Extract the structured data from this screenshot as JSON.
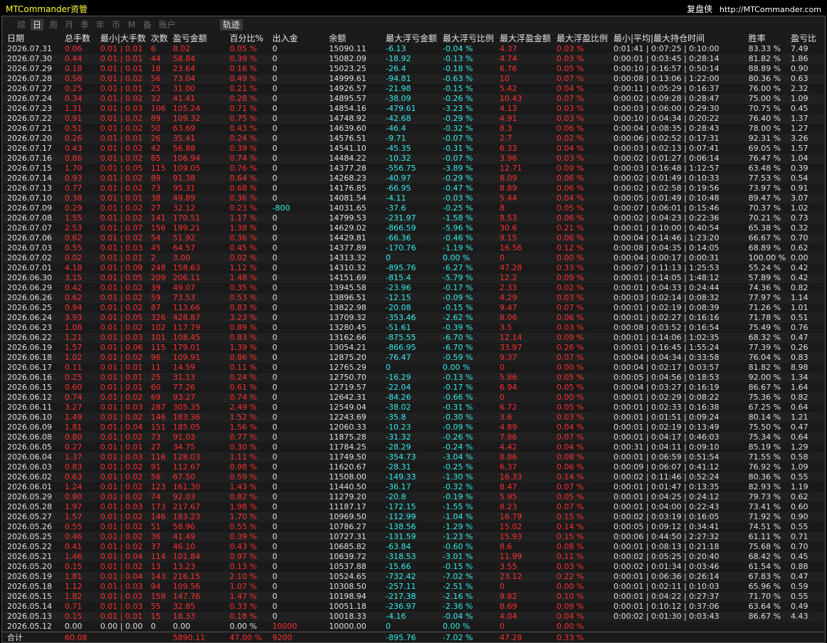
{
  "app": {
    "title": "MTCommander资管",
    "brand_name": "复盘侠",
    "brand_url": "http://MTCommander.com"
  },
  "tabs": [
    "综",
    "日",
    "周",
    "月",
    "季",
    "年",
    "币",
    "M",
    "备",
    "账户"
  ],
  "active_tab": "日",
  "trail_button": "轨迹",
  "colors": {
    "profit": "#ff3030",
    "loss": "#33eeee",
    "title": "#ffff33"
  },
  "columns": [
    "日期",
    "总手数",
    "最小|大手数",
    "次数",
    "盈亏金额",
    "百分比%",
    "出入金",
    "余额",
    "最大浮亏金额",
    "最大浮亏比例",
    "最大浮盈金额",
    "最大浮盈比例",
    "最小|平均|最大持仓时间",
    "胜率",
    "盈亏比"
  ],
  "rows": [
    [
      "2026.07.31",
      "0.06",
      "0.01 | 0.01",
      "6",
      "8.02",
      "0.05 %",
      "0",
      "15090.11",
      "-6.13",
      "-0.04 %",
      "4.37",
      "0.03 %",
      "0:01:41 | 0:07:25 | 0:10:00",
      "83.33 %",
      "7.49"
    ],
    [
      "2026.07.30",
      "0.44",
      "0.01 | 0.01",
      "44",
      "58.84",
      "0.39 %",
      "0",
      "15082.09",
      "-18.92",
      "-0.13 %",
      "4.74",
      "0.03 %",
      "0:00:01 | 0:03:45 | 0:28:14",
      "81.82 %",
      "1.86"
    ],
    [
      "2026.07.29",
      "0.18",
      "0.01 | 0.01",
      "18",
      "23.64",
      "0.16 %",
      "0",
      "15023.25",
      "-26.4",
      "-0.18 %",
      "6.76",
      "0.05 %",
      "0:00:10 | 0:16:57 | 0:50:14",
      "88.89 %",
      "0.90"
    ],
    [
      "2026.07.28",
      "0.58",
      "0.01 | 0.02",
      "56",
      "73.04",
      "0.49 %",
      "0",
      "14999.61",
      "-94.81",
      "-0.63 %",
      "10",
      "0.07 %",
      "0:00:08 | 0:13:06 | 1:22:00",
      "80.36 %",
      "0.63"
    ],
    [
      "2026.07.27",
      "0.25",
      "0.01 | 0.01",
      "25",
      "31.00",
      "0.21 %",
      "0",
      "14926.57",
      "-21.98",
      "-0.15 %",
      "5.42",
      "0.04 %",
      "0:00:11 | 0:05:29 | 0:16:37",
      "76.00 %",
      "2.32"
    ],
    [
      "2026.07.24",
      "0.34",
      "0.01 | 0.02",
      "32",
      "41.41",
      "0.28 %",
      "0",
      "14895.57",
      "-38.09",
      "-0.26 %",
      "10.43",
      "0.07 %",
      "0:00:02 | 0:09:28 | 0:28:47",
      "75.00 %",
      "1.09"
    ],
    [
      "2026.07.23",
      "1.31",
      "0.01 | 0.03",
      "106",
      "105.24",
      "0.71 %",
      "0",
      "14854.16",
      "-479.61",
      "-3.23 %",
      "4.13",
      "0.03 %",
      "0:00:03 | 0:06:00 | 0:29:30",
      "70.75 %",
      "0.45"
    ],
    [
      "2026.07.22",
      "0.91",
      "0.01 | 0.02",
      "89",
      "109.32",
      "0.75 %",
      "0",
      "14748.92",
      "-42.68",
      "-0.29 %",
      "4.91",
      "0.03 %",
      "0:00:10 | 0:04:34 | 0:20:22",
      "76.40 %",
      "1.37"
    ],
    [
      "2026.07.21",
      "0.51",
      "0.01 | 0.02",
      "50",
      "63.69",
      "0.43 %",
      "0",
      "14639.60",
      "-46.4",
      "-0.32 %",
      "8.3",
      "0.06 %",
      "0:00:04 | 0:08:35 | 0:28:43",
      "78.00 %",
      "1.27"
    ],
    [
      "2026.07.20",
      "0.26",
      "0.01 | 0.01",
      "26",
      "35.41",
      "0.24 %",
      "0",
      "14576.51",
      "-9.71",
      "-0.07 %",
      "2.7",
      "0.02 %",
      "0:00:06 | 0:02:52 | 0:17:31",
      "92.31 %",
      "3.26"
    ],
    [
      "2026.07.17",
      "0.43",
      "0.01 | 0.02",
      "42",
      "56.88",
      "0.39 %",
      "0",
      "14541.10",
      "-45.35",
      "-0.31 %",
      "6.33",
      "0.04 %",
      "0:00:03 | 0:02:13 | 0:07:41",
      "69.05 %",
      "1.57"
    ],
    [
      "2026.07.16",
      "0.86",
      "0.01 | 0.02",
      "85",
      "106.94",
      "0.74 %",
      "0",
      "14484.22",
      "-10.32",
      "-0.07 %",
      "3.96",
      "0.03 %",
      "0:00:02 | 0:01:27 | 0:06:14",
      "76.47 %",
      "1.04"
    ],
    [
      "2026.07.15",
      "1.70",
      "0.01 | 0.05",
      "115",
      "109.05",
      "0.76 %",
      "0",
      "14377.28",
      "-556.75",
      "-3.89 %",
      "12.71",
      "0.09 %",
      "0:00:03 | 0:16:48 | 1:12:57",
      "63.48 %",
      "0.39"
    ],
    [
      "2026.07.14",
      "0.93",
      "0.01 | 0.02",
      "89",
      "91.38",
      "0.64 %",
      "0",
      "14268.23",
      "-40.97",
      "-0.29 %",
      "8.09",
      "0.06 %",
      "0:00:02 | 0:01:49 | 0:10:33",
      "77.53 %",
      "0.54"
    ],
    [
      "2026.07.13",
      "0.77",
      "0.01 | 0.02",
      "73",
      "95.31",
      "0.68 %",
      "0",
      "14176.85",
      "-66.95",
      "-0.47 %",
      "8.89",
      "0.06 %",
      "0:00:02 | 0:02:58 | 0:19:56",
      "73.97 %",
      "0.91"
    ],
    [
      "2026.07.10",
      "0.38",
      "0.01 | 0.01",
      "38",
      "49.89",
      "0.36 %",
      "0",
      "14081.54",
      "-4.11",
      "-0.03 %",
      "5.44",
      "0.04 %",
      "0:00:05 | 0:01:49 | 0:10:48",
      "89.47 %",
      "3.07"
    ],
    [
      "2026.07.09",
      "0.29",
      "0.01 | 0.02",
      "27",
      "32.12",
      "0.23 %",
      "-800",
      "14031.65",
      "-37.6",
      "-0.25 %",
      "8",
      "0.05 %",
      "0:00:07 | 0:06:01 | 0:15:46",
      "70.37 %",
      "1.02"
    ],
    [
      "2026.07.08",
      "1.55",
      "0.01 | 0.02",
      "141",
      "170.51",
      "1.17 %",
      "0",
      "14799.53",
      "-231.97",
      "-1.58 %",
      "8.53",
      "0.06 %",
      "0:00:02 | 0:04:23 | 0:22:36",
      "70.21 %",
      "0.73"
    ],
    [
      "2026.07.07",
      "2.53",
      "0.01 | 0.07",
      "156",
      "199.21",
      "1.38 %",
      "0",
      "14629.02",
      "-866.59",
      "-5.96 %",
      "30.6",
      "0.21 %",
      "0:00:01 | 0:10:00 | 0:40:54",
      "65.38 %",
      "0.32"
    ],
    [
      "2026.07.06",
      "0.62",
      "0.01 | 0.02",
      "54",
      "51.92",
      "0.36 %",
      "0",
      "14429.81",
      "-66.36",
      "-0.46 %",
      "9.15",
      "0.06 %",
      "0:00:04 | 0:14:46 | 1:23:20",
      "66.67 %",
      "0.70"
    ],
    [
      "2026.07.03",
      "0.55",
      "0.01 | 0.03",
      "45",
      "64.57",
      "0.45 %",
      "0",
      "14377.89",
      "-170.76",
      "-1.19 %",
      "16.56",
      "0.12 %",
      "0:00:08 | 0:04:35 | 0:14:05",
      "68.89 %",
      "0.62"
    ],
    [
      "2026.07.02",
      "0.02",
      "0.01 | 0.01",
      "2",
      "3.00",
      "0.02 %",
      "0",
      "14313.32",
      "0",
      "0.00 %",
      "0",
      "0.00 %",
      "0:00:04 | 0:00:17 | 0:00:31",
      "100.00 %",
      "0.00"
    ],
    [
      "2026.07.01",
      "4.18",
      "0.01 | 0.09",
      "248",
      "158.63",
      "1.12 %",
      "0",
      "14310.32",
      "-895.76",
      "-6.27 %",
      "47.28",
      "0.33 %",
      "0:00:07 | 0:11:13 | 1:25:53",
      "55.24 %",
      "0.42"
    ],
    [
      "2026.06.30",
      "3.15",
      "0.01 | 0.05",
      "209",
      "206.11",
      "1.48 %",
      "0",
      "14151.69",
      "-815.4",
      "-5.79 %",
      "12.2",
      "0.09 %",
      "0:00:01 | 0:14:05 | 1:48:12",
      "57.89 %",
      "0.42"
    ],
    [
      "2026.06.29",
      "0.42",
      "0.01 | 0.02",
      "39",
      "49.07",
      "0.35 %",
      "0",
      "13945.58",
      "-23.96",
      "-0.17 %",
      "2.33",
      "0.02 %",
      "0:00:01 | 0:04:33 | 0:24:44",
      "74.36 %",
      "0.82"
    ],
    [
      "2026.06.26",
      "0.62",
      "0.01 | 0.02",
      "59",
      "73.53",
      "0.53 %",
      "0",
      "13896.51",
      "-12.15",
      "-0.09 %",
      "4.29",
      "0.03 %",
      "0:00:03 | 0:02:14 | 0:08:32",
      "77.97 %",
      "1.14"
    ],
    [
      "2026.06.25",
      "0.94",
      "0.01 | 0.02",
      "87",
      "113.66",
      "0.83 %",
      "0",
      "13822.98",
      "-20.08",
      "-0.15 %",
      "9.47",
      "0.07 %",
      "0:00:01 | 0:02:19 | 0:08:39",
      "71.26 %",
      "1.01"
    ],
    [
      "2026.06.24",
      "3.93",
      "0.01 | 0.05",
      "326",
      "428.87",
      "3.23 %",
      "0",
      "13709.32",
      "-353.46",
      "-2.62 %",
      "8.06",
      "0.06 %",
      "0:00:01 | 0:02:27 | 0:16:16",
      "71.78 %",
      "0.51"
    ],
    [
      "2026.06.23",
      "1.08",
      "0.01 | 0.02",
      "102",
      "117.79",
      "0.89 %",
      "0",
      "13280.45",
      "-51.61",
      "-0.39 %",
      "3.5",
      "0.03 %",
      "0:00:08 | 0:03:52 | 0:16:54",
      "75.49 %",
      "0.76"
    ],
    [
      "2026.06.22",
      "1.21",
      "0.01 | 0.03",
      "101",
      "108.45",
      "0.83 %",
      "0",
      "13162.66",
      "-875.55",
      "-6.70 %",
      "12.14",
      "0.09 %",
      "0:00:01 | 0:14:06 | 1:02:35",
      "68.32 %",
      "0.47"
    ],
    [
      "2026.06.19",
      "1.57",
      "0.01 | 0.06",
      "115",
      "179.01",
      "1.39 %",
      "0",
      "13054.21",
      "-866.95",
      "-6.70 %",
      "33.97",
      "0.26 %",
      "0:00:01 | 0:16:45 | 1:55:24",
      "77.39 %",
      "0.26"
    ],
    [
      "2026.06.18",
      "1.02",
      "0.01 | 0.02",
      "96",
      "109.91",
      "0.86 %",
      "0",
      "12875.20",
      "-76.47",
      "-0.59 %",
      "9.37",
      "0.07 %",
      "0:00:04 | 0:04:34 | 0:33:58",
      "76.04 %",
      "0.83"
    ],
    [
      "2026.06.17",
      "0.11",
      "0.01 | 0.01",
      "11",
      "14.59",
      "0.11 %",
      "0",
      "12765.29",
      "0",
      "0.00 %",
      "0",
      "0.00 %",
      "0:00:04 | 0:02:17 | 0:03:57",
      "81.82 %",
      "8.98"
    ],
    [
      "2026.06.16",
      "0.25",
      "0.01 | 0.01",
      "25",
      "31.13",
      "0.24 %",
      "0",
      "12750.70",
      "-16.29",
      "-0.13 %",
      "5.86",
      "0.05 %",
      "0:00:05 | 0:04:56 | 0:18:53",
      "92.00 %",
      "1.34"
    ],
    [
      "2026.06.15",
      "0.60",
      "0.01 | 0.01",
      "60",
      "77.26",
      "0.61 %",
      "0",
      "12719.57",
      "-22.04",
      "-0.17 %",
      "6.94",
      "0.05 %",
      "0:00:04 | 0:03:27 | 0:16:19",
      "86.67 %",
      "1.64"
    ],
    [
      "2026.06.12",
      "0.74",
      "0.01 | 0.02",
      "69",
      "93.27",
      "0.74 %",
      "0",
      "12642.31",
      "-84.26",
      "-0.66 %",
      "0",
      "0.00 %",
      "0:00:01 | 0:02:29 | 0:08:22",
      "75.36 %",
      "0.82"
    ],
    [
      "2026.06.11",
      "3.27",
      "0.01 | 0.03",
      "287",
      "305.35",
      "2.49 %",
      "0",
      "12549.04",
      "-38.02",
      "-0.31 %",
      "6.72",
      "0.05 %",
      "0:00:01 | 0:02:33 | 0:16:38",
      "67.25 %",
      "0.64"
    ],
    [
      "2026.06.10",
      "1.49",
      "0.01 | 0.02",
      "146",
      "183.36",
      "1.52 %",
      "0",
      "12243.69",
      "-35.8",
      "-0.30 %",
      "3.6",
      "0.03 %",
      "0:00:01 | 0:01:51 | 0:09:24",
      "80.14 %",
      "1.21"
    ],
    [
      "2026.06.09",
      "1.81",
      "0.01 | 0.04",
      "151",
      "185.05",
      "1.56 %",
      "0",
      "12060.33",
      "-10.23",
      "-0.09 %",
      "4.89",
      "0.04 %",
      "0:00:01 | 0:02:19 | 0:13:49",
      "75.50 %",
      "0.47"
    ],
    [
      "2026.06.08",
      "0.80",
      "0.01 | 0.02",
      "73",
      "91.03",
      "0.77 %",
      "0",
      "11875.28",
      "-31.32",
      "-0.26 %",
      "7.86",
      "0.07 %",
      "0:00:01 | 0:04:17 | 0:46:03",
      "75.34 %",
      "0.64"
    ],
    [
      "2026.06.05",
      "0.27",
      "0.01 | 0.01",
      "27",
      "34.75",
      "0.30 %",
      "0",
      "11784.25",
      "-28.29",
      "-0.24 %",
      "4.42",
      "0.04 %",
      "0:00:31 | 0:04:11 | 0:09:10",
      "85.19 %",
      "1.29"
    ],
    [
      "2026.06.04",
      "1.37",
      "0.01 | 0.03",
      "116",
      "128.03",
      "1.11 %",
      "0",
      "11749.50",
      "-354.73",
      "-3.04 %",
      "8.86",
      "0.08 %",
      "0:00:01 | 0:06:59 | 0:51:54",
      "71.55 %",
      "0.58"
    ],
    [
      "2026.06.03",
      "0.83",
      "0.01 | 0.02",
      "91",
      "112.67",
      "0.98 %",
      "0",
      "11620.67",
      "-28.31",
      "-0.25 %",
      "6.37",
      "0.06 %",
      "0:00:09 | 0:06:07 | 0:41:12",
      "76.92 %",
      "1.09"
    ],
    [
      "2026.06.02",
      "0.63",
      "0.01 | 0.02",
      "56",
      "67.50",
      "0.59 %",
      "0",
      "11508.00",
      "-149.33",
      "-1.30 %",
      "16.33",
      "0.14 %",
      "0:00:02 | 0:11:46 | 0:52:24",
      "80.36 %",
      "0.55"
    ],
    [
      "2026.06.01",
      "1.24",
      "0.01 | 0.02",
      "123",
      "161.30",
      "1.43 %",
      "0",
      "11440.50",
      "-36.17",
      "-0.32 %",
      "8.47",
      "0.07 %",
      "0:00:01 | 0:01:47 | 0:13:35",
      "82.93 %",
      "1.19"
    ],
    [
      "2026.05.29",
      "0.80",
      "0.01 | 0.02",
      "74",
      "92.03",
      "0.82 %",
      "0",
      "11279.20",
      "-20.8",
      "-0.19 %",
      "5.95",
      "0.05 %",
      "0:00:01 | 0:04:25 | 0:24:12",
      "79.73 %",
      "0.62"
    ],
    [
      "2026.05.28",
      "1.97",
      "0.01 | 0.03",
      "173",
      "217.67",
      "1.98 %",
      "0",
      "11187.17",
      "-172.15",
      "-1.55 %",
      "8.23",
      "0.07 %",
      "0:00:01 | 0:04:00 | 0:22:43",
      "73.41 %",
      "0.60"
    ],
    [
      "2026.05.27",
      "1.57",
      "0.01 | 0.02",
      "146",
      "183.23",
      "1.70 %",
      "0",
      "10969.50",
      "-112.99",
      "-1.04 %",
      "16.79",
      "0.15 %",
      "0:00:02 | 0:03:19 | 0:16:05",
      "71.92 %",
      "0.90"
    ],
    [
      "2026.05.26",
      "0.55",
      "0.01 | 0.02",
      "51",
      "58.96",
      "0.55 %",
      "0",
      "10786.27",
      "-138.56",
      "-1.29 %",
      "15.02",
      "0.14 %",
      "0:00:05 | 0:09:12 | 0:34:41",
      "74.51 %",
      "0.55"
    ],
    [
      "2026.05.25",
      "0.46",
      "0.01 | 0.02",
      "36",
      "41.49",
      "0.39 %",
      "0",
      "10727.31",
      "-131.59",
      "-1.23 %",
      "15.93",
      "0.15 %",
      "0:00:06 | 0:44:50 | 2:27:32",
      "61.11 %",
      "0.71"
    ],
    [
      "2026.05.22",
      "0.41",
      "0.01 | 0.02",
      "37",
      "46.10",
      "0.43 %",
      "0",
      "10685.82",
      "-63.84",
      "-0.60 %",
      "8.6",
      "0.08 %",
      "0:00:01 | 0:08:13 | 0:21:18",
      "75.68 %",
      "0.70"
    ],
    [
      "2026.05.21",
      "1.46",
      "0.01 | 0.04",
      "114",
      "101.84",
      "0.97 %",
      "0",
      "10639.72",
      "-318.53",
      "-3.01 %",
      "11.99",
      "0.11 %",
      "0:00:02 | 0:05:25 | 0:20:40",
      "68.42 %",
      "0.45"
    ],
    [
      "2026.05.20",
      "0.15",
      "0.01 | 0.02",
      "13",
      "13.23",
      "0.13 %",
      "0",
      "10537.88",
      "-15.66",
      "-0.15 %",
      "3.55",
      "0.03 %",
      "0:00:02 | 0:01:34 | 0:03:46",
      "61.54 %",
      "0.88"
    ],
    [
      "2026.05.19",
      "1.81",
      "0.01 | 0.04",
      "143",
      "216.15",
      "2.10 %",
      "0",
      "10524.65",
      "-732.42",
      "-7.02 %",
      "23.12",
      "0.22 %",
      "0:00:01 | 0:06:36 | 0:26:14",
      "67.83 %",
      "0.47"
    ],
    [
      "2026.05.18",
      "1.12",
      "0.01 | 0.03",
      "94",
      "109.56",
      "1.07 %",
      "0",
      "10308.50",
      "-257.11",
      "-2.51 %",
      "0",
      "0.00 %",
      "0:00:01 | 0:02:11 | 0:10:03",
      "65.96 %",
      "0.59"
    ],
    [
      "2026.05.15",
      "1.82",
      "0.01 | 0.02",
      "159",
      "147.76",
      "1.47 %",
      "0",
      "10198.94",
      "-217.38",
      "-2.16 %",
      "9.82",
      "0.10 %",
      "0:00:01 | 0:04:22 | 0:27:37",
      "71.70 %",
      "0.55"
    ],
    [
      "2026.05.14",
      "0.71",
      "0.01 | 0.03",
      "55",
      "32.85",
      "0.33 %",
      "0",
      "10051.18",
      "-236.97",
      "-2.36 %",
      "8.69",
      "0.09 %",
      "0:00:01 | 0:10:12 | 0:37:06",
      "63.64 %",
      "0.49"
    ],
    [
      "2026.05.13",
      "0.15",
      "0.01 | 0.01",
      "15",
      "18.33",
      "0.18 %",
      "0",
      "10018.33",
      "-4.16",
      "-0.04 %",
      "4.04",
      "0.04 %",
      "0:00:02 | 0:01:30 | 0:03:43",
      "86.67 %",
      "4.43"
    ],
    [
      "2026.05.12",
      "0.00",
      "0.00 | 0.00",
      "0",
      "0.00",
      "0.00 %",
      "10000",
      "10000.00",
      "0",
      "0.00 %",
      "0",
      "0.00 %",
      "",
      "",
      ""
    ]
  ],
  "totals": [
    "合计",
    "60.08",
    "",
    "",
    "5890.11",
    "47.00 %",
    "9200",
    "",
    "-895.76",
    "-7.02 %",
    "47.28",
    "0.33 %",
    "",
    "",
    ""
  ]
}
